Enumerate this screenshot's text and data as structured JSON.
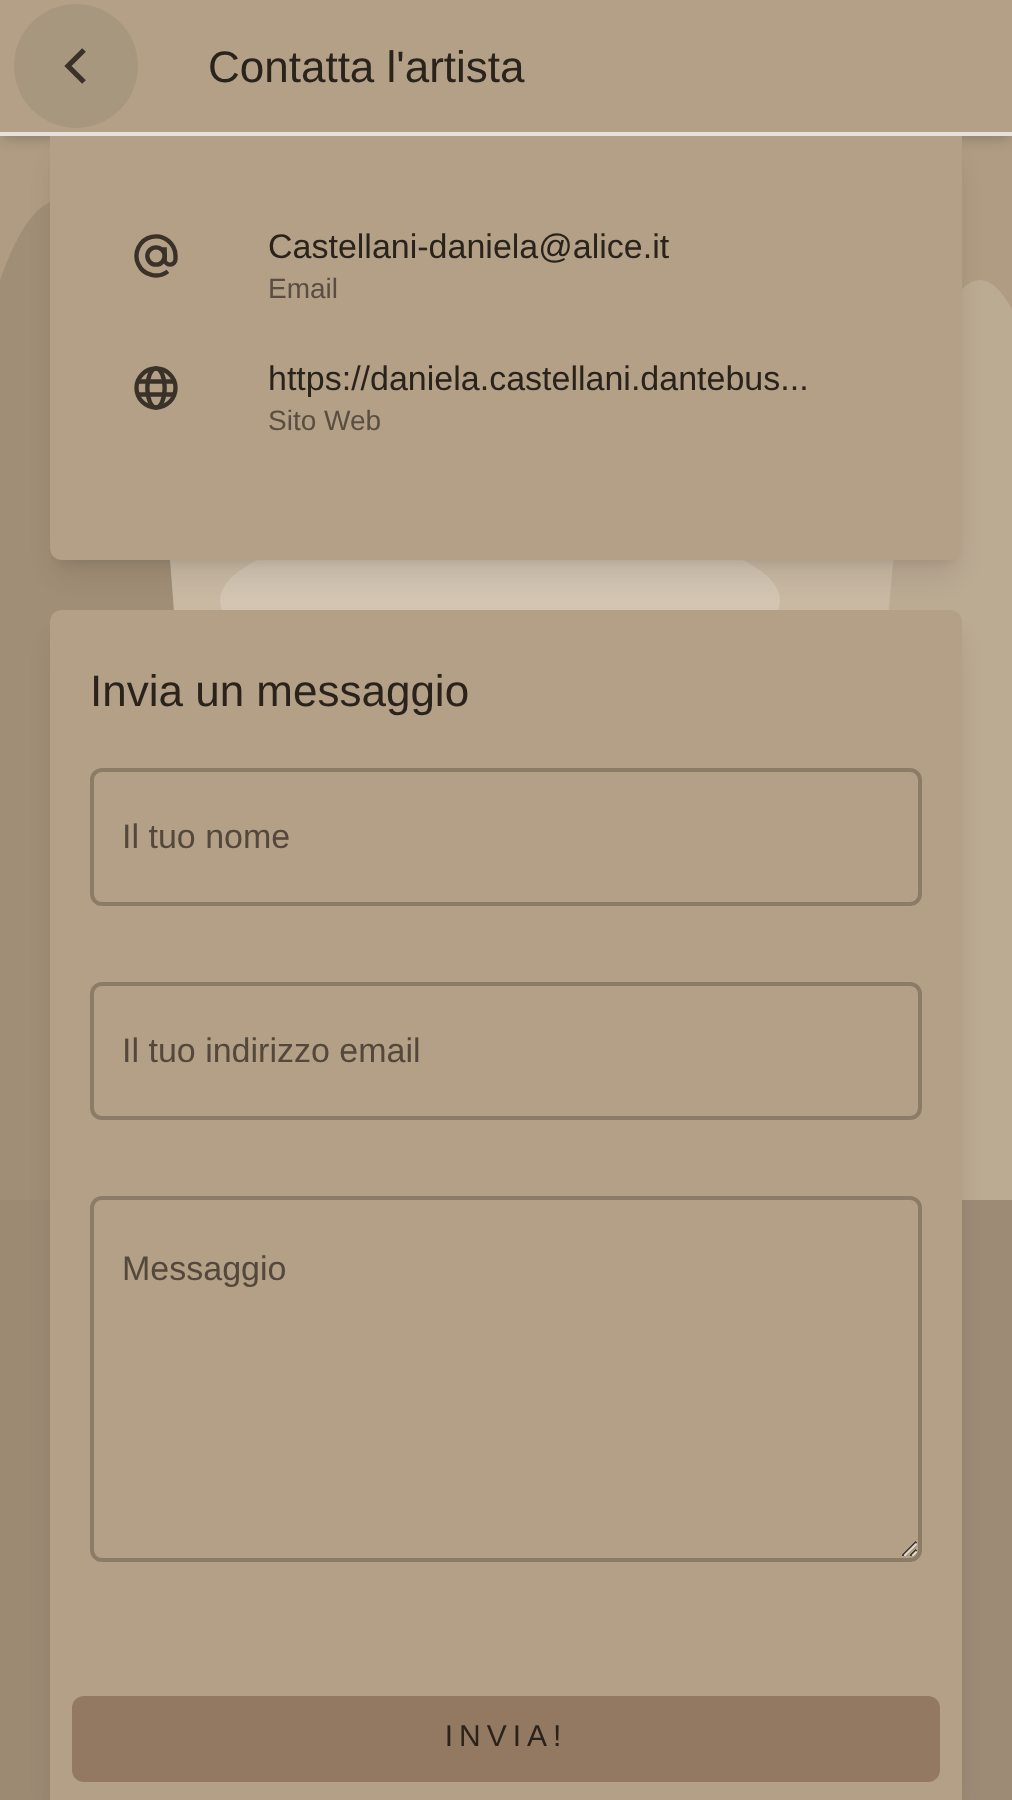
{
  "header": {
    "title": "Contatta l'artista"
  },
  "contacts": [
    {
      "kind": "email",
      "value": "Castellani-daniela@alice.it",
      "label": "Email"
    },
    {
      "kind": "web",
      "value": "https://daniela.castellani.dantebus...",
      "label": "Sito Web"
    }
  ],
  "form": {
    "title": "Invia un messaggio",
    "fields": [
      {
        "kind": "input",
        "placeholder": "Il tuo nome"
      },
      {
        "kind": "input",
        "placeholder": "Il tuo indirizzo email"
      },
      {
        "kind": "textarea",
        "placeholder": "Messaggio"
      }
    ],
    "submit": "INVIA!"
  }
}
